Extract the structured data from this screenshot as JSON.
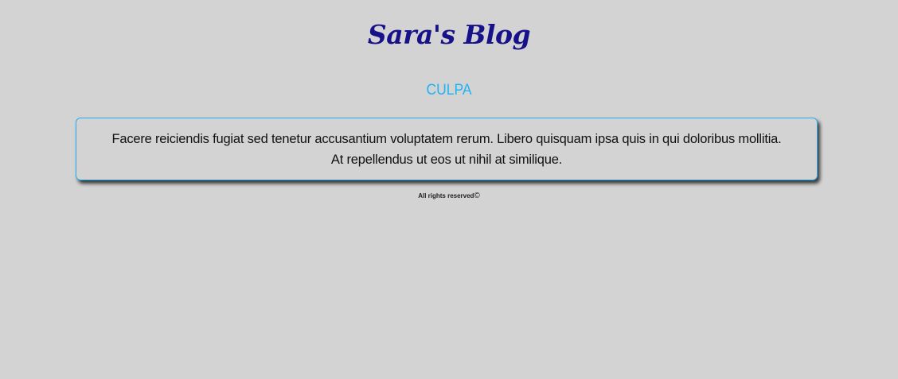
{
  "header": {
    "blog_title": "Sara's Blog"
  },
  "post": {
    "title": "CULPA",
    "body": "Facere reiciendis fugiat sed tenetur accusantium voluptatem rerum. Libero quisquam ipsa quis in qui doloribus mollitia. At repellendus ut eos ut nihil at similique."
  },
  "footer": {
    "text": "All rights reserved",
    "copyright_symbol": "©"
  },
  "colors": {
    "background": "#d3d3d3",
    "blog_title": "#17118a",
    "post_title": "#1eb4f5",
    "card_border": "#22aef0"
  }
}
